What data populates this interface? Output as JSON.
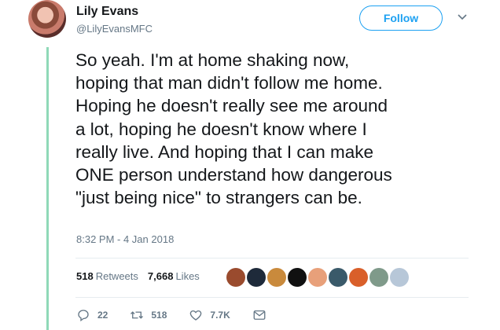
{
  "user": {
    "name": "Lily Evans",
    "handle": "@LilyEvansMFC",
    "follow_label": "Follow"
  },
  "tweet": {
    "text": "So yeah. I'm at home shaking now,\nhoping that man didn't follow me home.\nHoping he doesn't really see me around\na lot, hoping he doesn't know where I\nreally live. And hoping that I can make\nONE person understand how dangerous\n\"just being nice\" to strangers can be.",
    "timestamp": "8:32 PM - 4 Jan 2018"
  },
  "stats": {
    "retweets_count": "518",
    "retweets_label": "Retweets",
    "likes_count": "7,668",
    "likes_label": "Likes"
  },
  "likers": [
    {
      "color": "#9a4b2e"
    },
    {
      "color": "#1e2a3a"
    },
    {
      "color": "#c98a3c"
    },
    {
      "color": "#111111"
    },
    {
      "color": "#e8a07a"
    },
    {
      "color": "#3a5a6a"
    },
    {
      "color": "#d95f2a"
    },
    {
      "color": "#7f9a8a"
    },
    {
      "color": "#b7c7d8"
    }
  ],
  "actions": {
    "reply_count": "22",
    "retweet_count": "518",
    "like_count": "7.7K"
  },
  "colors": {
    "accent": "#1da1f2",
    "thread_line": "#8fd9b8",
    "muted": "#657786"
  }
}
